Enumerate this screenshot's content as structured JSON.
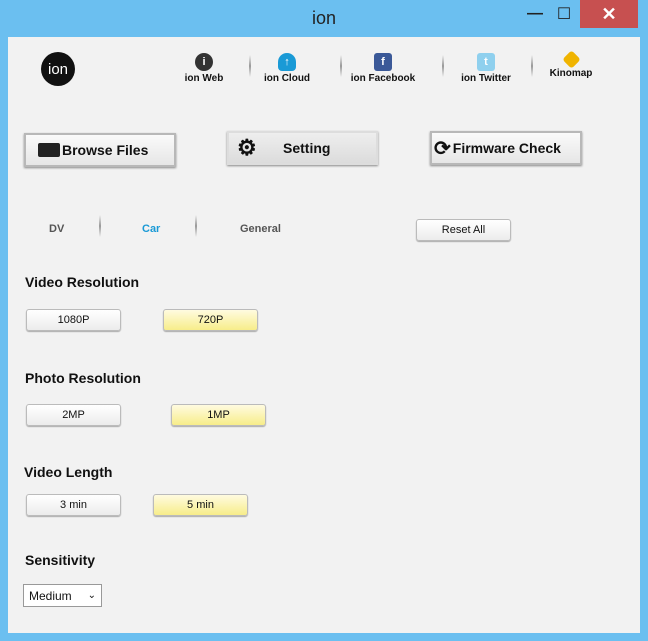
{
  "window": {
    "title": "ion",
    "minimize": "—",
    "maximize": "☐",
    "close": "✕"
  },
  "logo": "ion",
  "links": [
    {
      "label": "ion Web",
      "icon": "ion-web-icon"
    },
    {
      "label": "ion Cloud",
      "icon": "cloud-upload-icon"
    },
    {
      "label": "ion Facebook",
      "icon": "facebook-icon"
    },
    {
      "label": "ion Twitter",
      "icon": "twitter-icon"
    },
    {
      "label": "Kinomap",
      "icon": "kinomap-icon"
    }
  ],
  "toolbar": {
    "browse": "Browse Files",
    "setting": "Setting",
    "firmware": "Firmware Check"
  },
  "tabs": [
    {
      "label": "DV"
    },
    {
      "label": "Car",
      "active": true
    },
    {
      "label": "General"
    }
  ],
  "reset_all": "Reset All",
  "video_resolution": {
    "heading": "Video Resolution",
    "options": [
      "1080P",
      "720P"
    ],
    "selected": "720P"
  },
  "photo_resolution": {
    "heading": "Photo Resolution",
    "options": [
      "2MP",
      "1MP"
    ],
    "selected": "1MP"
  },
  "video_length": {
    "heading": "Video Length",
    "options": [
      "3 min",
      "5 min"
    ],
    "selected": "5 min"
  },
  "sensitivity": {
    "heading": "Sensitivity",
    "value": "Medium"
  },
  "colors": {
    "accent": "#1a9ad6",
    "selected": "#f7ed8a",
    "titlebar": "#6bbff0",
    "close": "#c75050"
  }
}
